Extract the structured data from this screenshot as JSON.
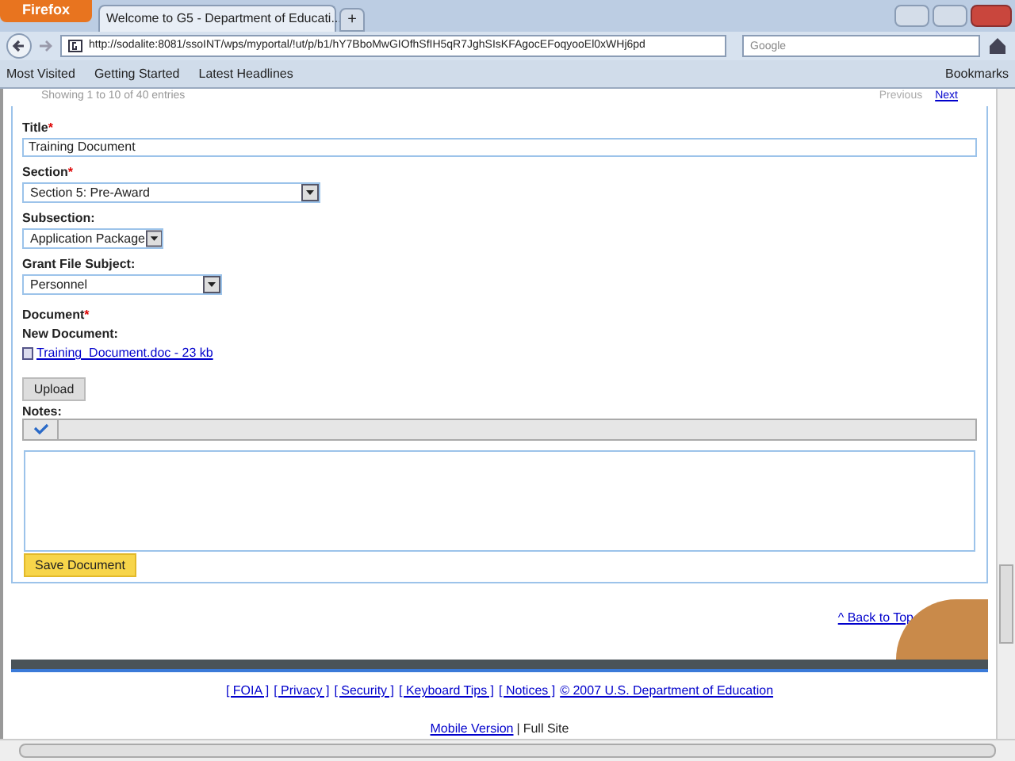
{
  "browser": {
    "menu_button": "Firefox",
    "tabs": [
      {
        "title": "Welcome to G5 - Department of Educati...",
        "selected": true
      }
    ],
    "new_tab": "+",
    "url": "http://sodalite:8081/ssoINT/wps/myportal/!ut/p/b1/hY7BboMwGIOfhSfIH5qR7JghSIsKFAgocEFoqyooEl0xWHj6pd",
    "search_placeholder": "Google",
    "bookmarks": [
      "Most Visited",
      "Getting Started",
      "Latest Headlines"
    ],
    "bookmarks_menu": "Bookmarks"
  },
  "pager": {
    "info": "Showing 1 to 10 of 40 entries",
    "previous": "Previous",
    "next": "Next"
  },
  "form": {
    "fields": [
      {
        "kind": "text",
        "label": "Title",
        "required": true,
        "value": "Training Document"
      },
      {
        "kind": "select",
        "label": "Section",
        "required": true,
        "value": "Section 5: Pre-Award"
      },
      {
        "kind": "select",
        "label": "Subsection:",
        "required": false,
        "value": "Application Package"
      },
      {
        "kind": "select",
        "label": "Grant File Subject:",
        "required": false,
        "value": "Personnel"
      }
    ],
    "required_mark": "*",
    "document_label": "Document",
    "document_required": true,
    "new_document_label": "New Document:",
    "file_link": "Training_Document.doc - 23 kb",
    "upload": "Upload",
    "notes_label": "Notes:",
    "save": "Save Document"
  },
  "back_to_top": "^ Back to Top",
  "footer_links": [
    "[ FOIA ]",
    "[ Privacy ]",
    "[ Security ]",
    "[ Keyboard Tips ]",
    "[ Notices ]",
    "© 2007 U.S. Department of Education"
  ],
  "mobile_link": "Mobile Version",
  "separator": "|",
  "full_site": "Full Site"
}
